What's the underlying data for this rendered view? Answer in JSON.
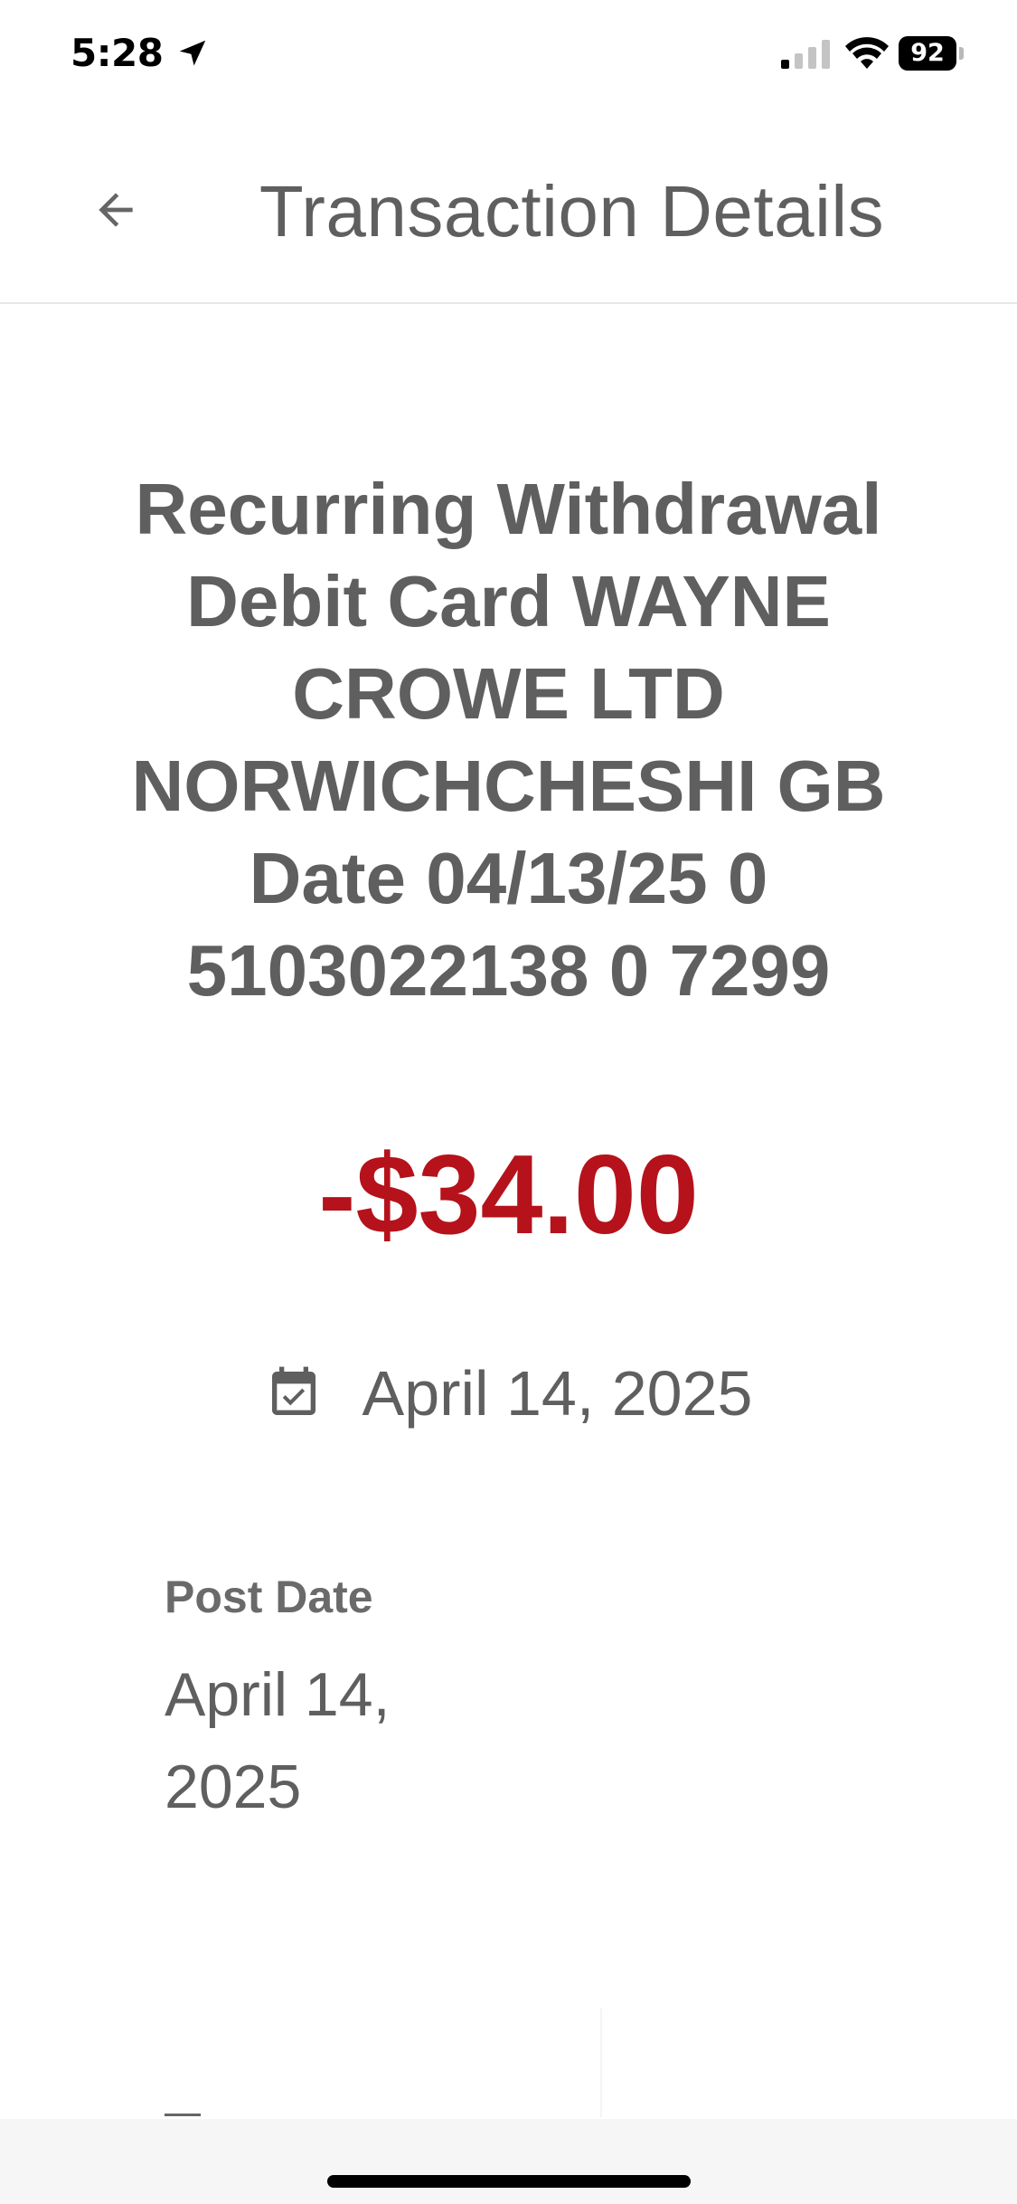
{
  "status_bar": {
    "time": "5:28",
    "battery": "92"
  },
  "header": {
    "title": "Transaction Details"
  },
  "transaction": {
    "description": "Recurring Withdrawal Debit Card WAYNE CROWE LTD NORWICHCHESHI GB Date 04/13/25 0 5103022138 0 7299",
    "amount": "-$34.00",
    "date": "April 14, 2025",
    "post_date_label": "Post Date",
    "post_date_value": "April 14, 2025"
  },
  "colors": {
    "amount_negative": "#b5121b",
    "text_primary": "#5f5f5f"
  },
  "icons": {
    "back": "arrow-left-icon",
    "calendar": "calendar-check-icon",
    "location": "location-arrow-icon",
    "signal": "cellular-signal-icon",
    "wifi": "wifi-icon",
    "battery": "battery-icon"
  }
}
